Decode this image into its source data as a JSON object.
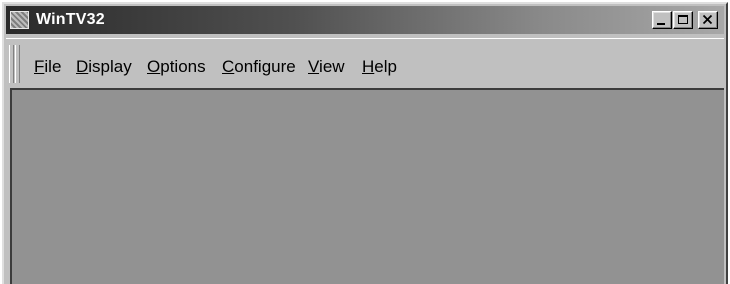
{
  "window": {
    "title": "WinTV32",
    "icon": "wintv-app-icon",
    "controls": [
      "minimize-icon",
      "maximize-icon",
      "close-icon"
    ]
  },
  "menu": {
    "items": [
      {
        "label": "File",
        "accel": "F",
        "rest": "ile"
      },
      {
        "label": "Display",
        "accel": "D",
        "rest": "isplay"
      },
      {
        "label": "Options",
        "accel": "O",
        "rest": "ptions"
      },
      {
        "label": "Configure",
        "accel": "C",
        "rest": "onfigure"
      },
      {
        "label": "View",
        "accel": "V",
        "rest": "iew"
      },
      {
        "label": "Help",
        "accel": "H",
        "rest": "elp"
      }
    ]
  },
  "colors": {
    "video_area": "#929292",
    "chrome": "#c0c0c0"
  }
}
